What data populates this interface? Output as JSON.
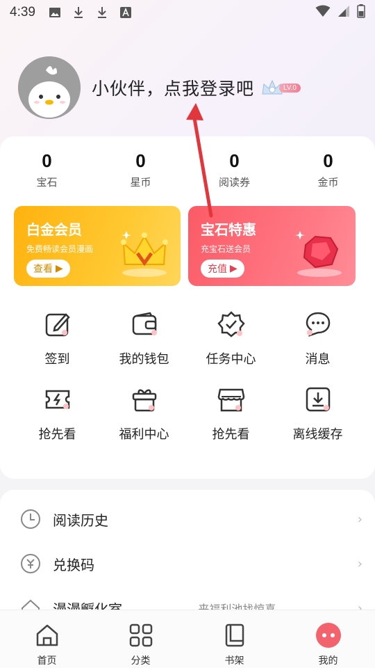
{
  "status_bar": {
    "time": "4:39"
  },
  "profile": {
    "login_prompt": "小伙伴，点我登录吧",
    "level": "LV.0"
  },
  "stats": [
    {
      "value": "0",
      "label": "宝石"
    },
    {
      "value": "0",
      "label": "星币"
    },
    {
      "value": "0",
      "label": "阅读券"
    },
    {
      "value": "0",
      "label": "金币"
    }
  ],
  "promos": {
    "gold": {
      "title": "白金会员",
      "subtitle": "免费畅读会员漫画",
      "button": "查看"
    },
    "red": {
      "title": "宝石特惠",
      "subtitle": "充宝石送会员",
      "button": "充值"
    }
  },
  "grid": [
    {
      "label": "签到",
      "icon": "edit-icon"
    },
    {
      "label": "我的钱包",
      "icon": "wallet-icon"
    },
    {
      "label": "任务中心",
      "icon": "badge-check-icon"
    },
    {
      "label": "消息",
      "icon": "chat-icon"
    },
    {
      "label": "抢先看",
      "icon": "ticket-icon"
    },
    {
      "label": "福利中心",
      "icon": "gift-icon"
    },
    {
      "label": "抢先看",
      "icon": "store-icon"
    },
    {
      "label": "离线缓存",
      "icon": "download-icon"
    }
  ],
  "list": [
    {
      "label": "阅读历史",
      "icon": "clock-icon"
    },
    {
      "label": "兑换码",
      "icon": "redeem-icon"
    },
    {
      "label": "漫漫孵化室",
      "icon": "house-icon",
      "extra": "来福利池找惊喜"
    }
  ],
  "tabs": [
    {
      "label": "首页",
      "icon": "home-icon"
    },
    {
      "label": "分类",
      "icon": "category-icon"
    },
    {
      "label": "书架",
      "icon": "bookshelf-icon"
    },
    {
      "label": "我的",
      "icon": "profile-icon"
    }
  ],
  "colors": {
    "accent": "#f2636e",
    "gold": "#ffb20f",
    "red": "#fb5b66"
  }
}
